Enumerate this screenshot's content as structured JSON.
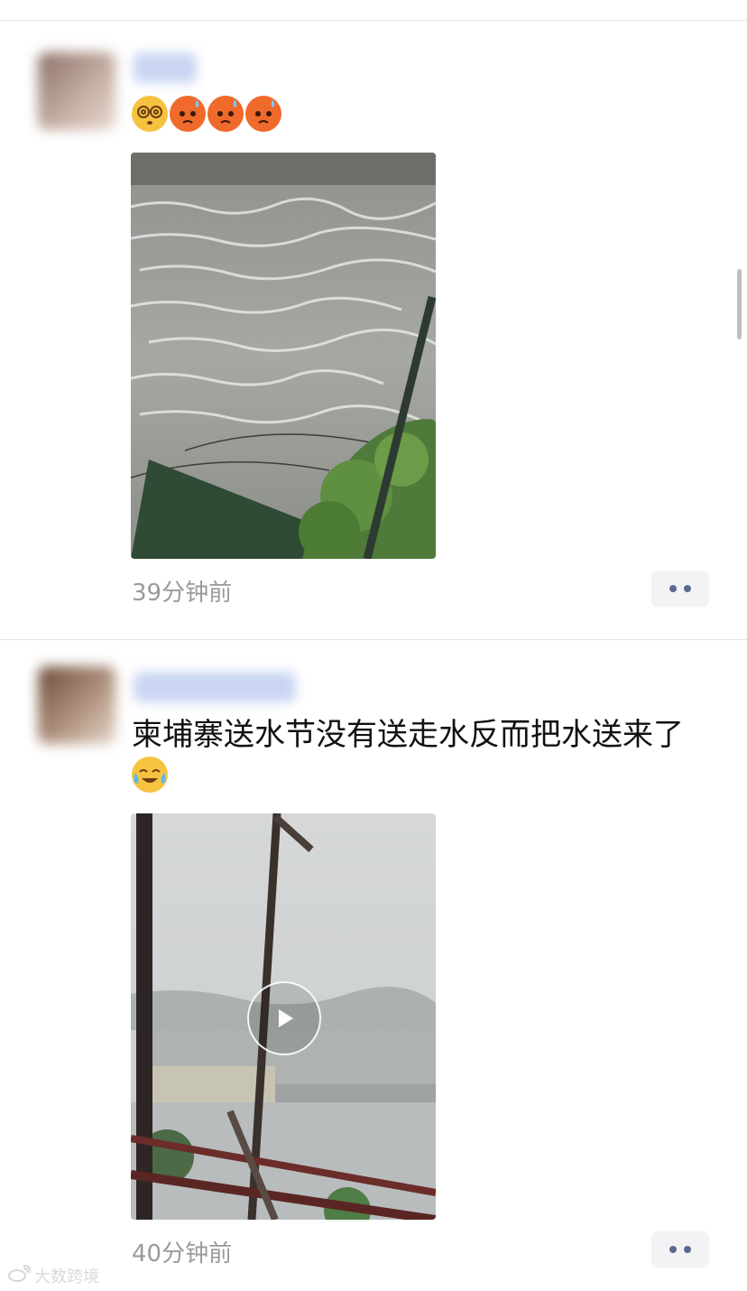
{
  "feed": {
    "posts": [
      {
        "text": "",
        "emojis": [
          "dizzy-face-emoji",
          "sweat-pout-emoji",
          "sweat-pout-emoji",
          "sweat-pout-emoji"
        ],
        "media_type": "image",
        "timestamp": "39分钟前"
      },
      {
        "text": "柬埔寨送水节没有送走水反而把水送来了",
        "emojis": [
          "crying-laughing-emoji"
        ],
        "media_type": "video",
        "timestamp": "40分钟前"
      }
    ]
  },
  "watermark": {
    "text": "大数跨境"
  },
  "icons": {
    "more": "more-dots-icon",
    "play": "play-icon"
  },
  "colors": {
    "timestamp": "#9a9a9a",
    "more_dots": "#5b6a8f",
    "divider": "#e6e6e6"
  }
}
